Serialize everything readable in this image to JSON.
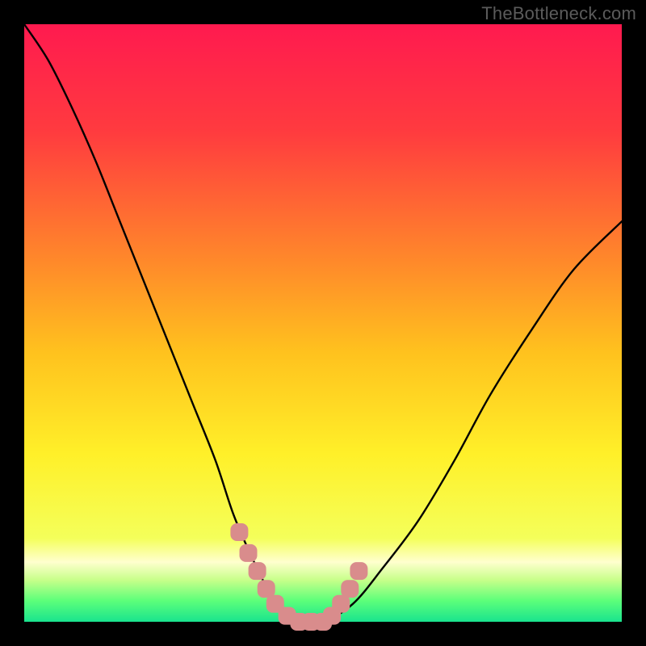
{
  "watermark": "TheBottleneck.com",
  "colors": {
    "frame": "#000000",
    "curve": "#000000",
    "marker": "#d98c8c",
    "gradient_stops": [
      {
        "offset": 0.0,
        "color": "#ff1a4f"
      },
      {
        "offset": 0.18,
        "color": "#ff3b3f"
      },
      {
        "offset": 0.4,
        "color": "#ff8a2a"
      },
      {
        "offset": 0.55,
        "color": "#ffc21e"
      },
      {
        "offset": 0.72,
        "color": "#fff029"
      },
      {
        "offset": 0.86,
        "color": "#f4ff5a"
      },
      {
        "offset": 0.9,
        "color": "#ffffce"
      },
      {
        "offset": 0.93,
        "color": "#c7ff8a"
      },
      {
        "offset": 0.965,
        "color": "#5cff7a"
      },
      {
        "offset": 1.0,
        "color": "#19e38e"
      }
    ]
  },
  "chart_data": {
    "type": "line",
    "title": "",
    "xlabel": "",
    "ylabel": "",
    "xlim": [
      0,
      100
    ],
    "ylim": [
      0,
      100
    ],
    "series": [
      {
        "name": "bottleneck-curve",
        "x": [
          0,
          4,
          8,
          12,
          16,
          20,
          24,
          28,
          32,
          35,
          38,
          41,
          44,
          47,
          50,
          55,
          60,
          66,
          72,
          78,
          85,
          92,
          100
        ],
        "y": [
          100,
          94,
          86,
          77,
          67,
          57,
          47,
          37,
          27,
          18,
          11,
          5,
          1,
          0,
          0,
          3,
          9,
          17,
          27,
          38,
          49,
          59,
          67
        ]
      }
    ],
    "markers": {
      "name": "highlight-region",
      "x": [
        36.0,
        37.5,
        39.0,
        40.5,
        42.0,
        44.0,
        46.0,
        48.0,
        50.0,
        51.5,
        53.0,
        54.5,
        56.0
      ],
      "y": [
        15.0,
        11.5,
        8.5,
        5.5,
        3.0,
        1.0,
        0.0,
        0.0,
        0.0,
        1.0,
        3.0,
        5.5,
        8.5
      ]
    }
  }
}
